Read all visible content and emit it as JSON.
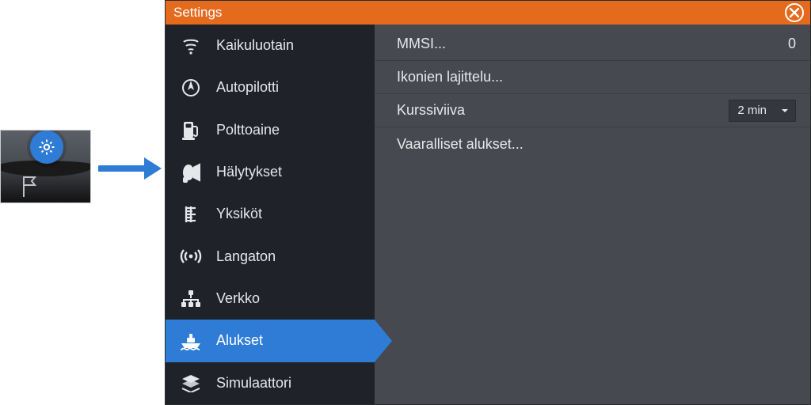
{
  "window": {
    "title": "Settings"
  },
  "sidebar": {
    "items": [
      {
        "label": "Kaikuluotain"
      },
      {
        "label": "Autopilotti"
      },
      {
        "label": "Polttoaine"
      },
      {
        "label": "Hälytykset"
      },
      {
        "label": "Yksiköt"
      },
      {
        "label": "Langaton"
      },
      {
        "label": "Verkko"
      },
      {
        "label": "Alukset"
      },
      {
        "label": "Simulaattori"
      }
    ],
    "active_index": 7
  },
  "content": {
    "rows": [
      {
        "label": "MMSI...",
        "value": "0",
        "type": "value"
      },
      {
        "label": "Ikonien lajittelu...",
        "type": "link"
      },
      {
        "label": "Kurssiviiva",
        "type": "select",
        "selected": "2 min"
      },
      {
        "label": "Vaaralliset alukset...",
        "type": "link"
      }
    ]
  },
  "icons": {
    "gear": "gear-icon",
    "flag": "flag-icon",
    "arrow": "arrow-right-icon",
    "close": "close-icon",
    "sonar": "sonar-icon",
    "autopilot": "autopilot-icon",
    "fuel": "fuel-icon",
    "alarm": "alarm-icon",
    "units": "units-icon",
    "wireless": "wireless-icon",
    "network": "network-icon",
    "vessels": "vessels-icon",
    "simulator": "simulator-icon",
    "chevron": "chevron-down-icon"
  },
  "colors": {
    "accent": "#e46a1e",
    "primary": "#2e7cd6",
    "panel": "#46494f",
    "sidebar": "#1f2228"
  }
}
